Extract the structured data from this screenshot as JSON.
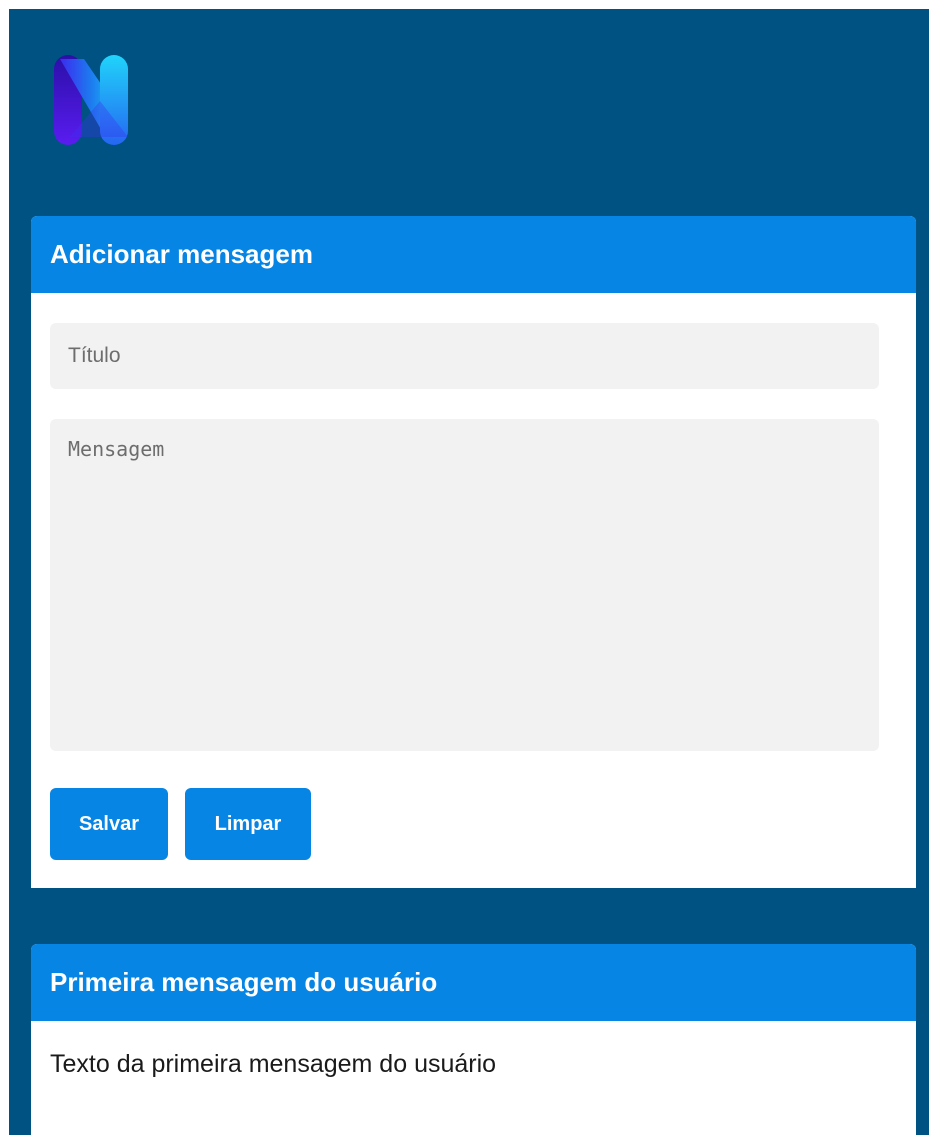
{
  "logo": {
    "icon": "m-logo-icon",
    "colors": {
      "dark": "#2a0fa8",
      "mid": "#4a2df2",
      "light": "#18c8f8"
    }
  },
  "add_message": {
    "header": "Adicionar mensagem",
    "title_placeholder": "Título",
    "title_value": "",
    "message_placeholder": "Mensagem",
    "message_value": "",
    "save_label": "Salvar",
    "clear_label": "Limpar"
  },
  "messages": [
    {
      "title": "Primeira mensagem do usuário",
      "body": "Texto da primeira mensagem do usuário"
    }
  ],
  "colors": {
    "background": "#005282",
    "accent": "#0685e5",
    "input_bg": "#f2f2f2",
    "card_bg": "#ffffff"
  }
}
